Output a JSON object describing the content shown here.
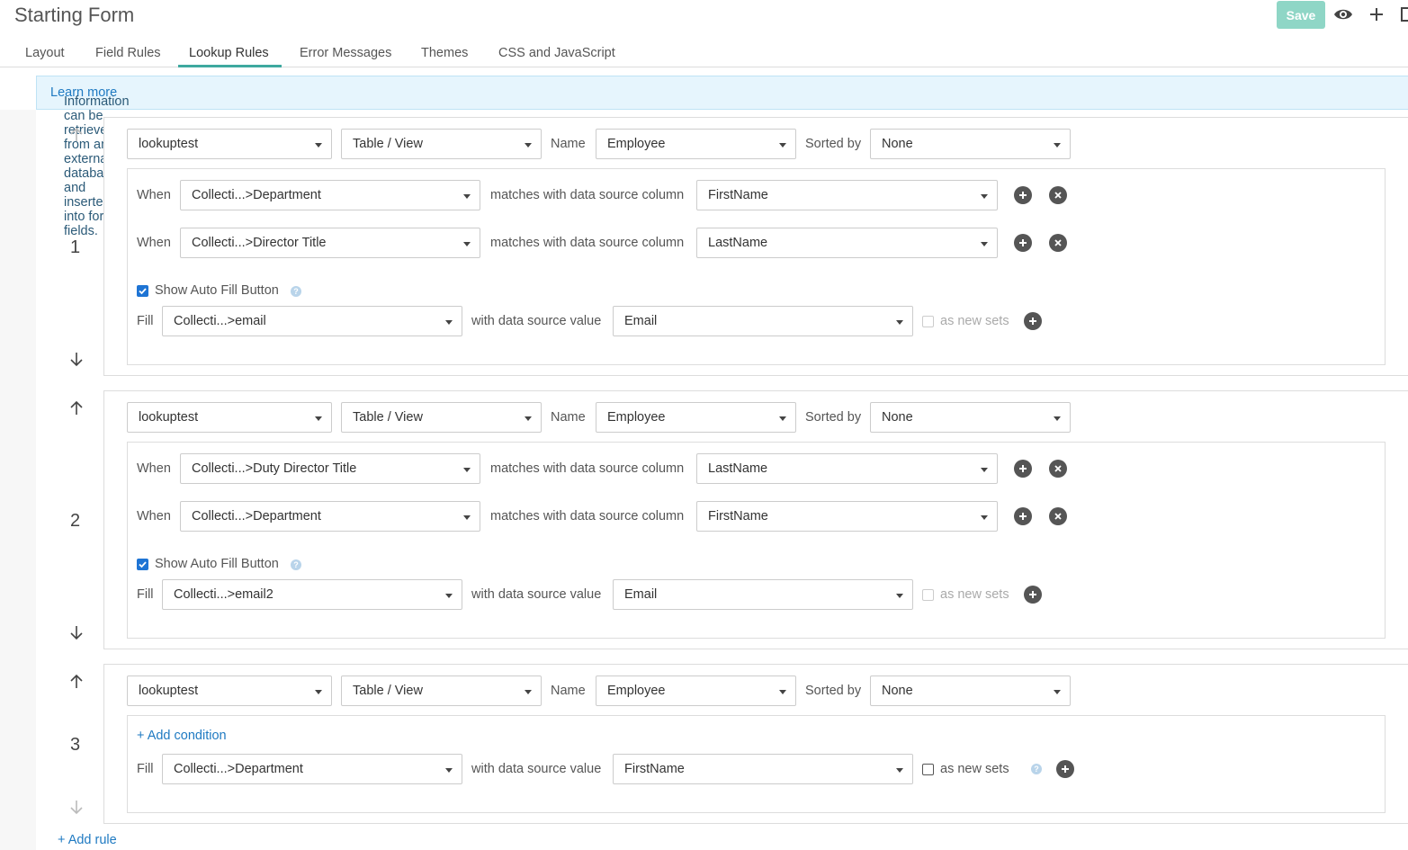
{
  "header": {
    "title": "Starting Form",
    "save_label": "Save"
  },
  "tabs": [
    {
      "label": "Layout"
    },
    {
      "label": "Field Rules"
    },
    {
      "label": "Lookup Rules"
    },
    {
      "label": "Error Messages"
    },
    {
      "label": "Themes"
    },
    {
      "label": "CSS and JavaScript"
    }
  ],
  "info": {
    "text": "Information can be retrieved from an external database and inserted into form fields.",
    "link": "Learn more"
  },
  "labels": {
    "name": "Name",
    "sorted_by": "Sorted by",
    "when": "When",
    "matches": "matches with data source column",
    "show_auto_fill": "Show Auto Fill Button",
    "fill": "Fill",
    "with_value": "with data source value",
    "as_new_sets": "as new sets",
    "add_condition": "+ Add condition",
    "add_rule": "+ Add rule"
  },
  "rules": [
    {
      "number": "1",
      "source": "lookuptest",
      "type": "Table / View",
      "name": "Employee",
      "sorted_by": "None",
      "conditions": [
        {
          "field": "Collecti...>Department",
          "column": "FirstName"
        },
        {
          "field": "Collecti...>Director Title",
          "column": "LastName"
        }
      ],
      "fill": {
        "field": "Collecti...>email",
        "value": "Email"
      }
    },
    {
      "number": "2",
      "source": "lookuptest",
      "type": "Table / View",
      "name": "Employee",
      "sorted_by": "None",
      "conditions": [
        {
          "field": "Collecti...>Duty Director Title",
          "column": "LastName"
        },
        {
          "field": "Collecti...>Department",
          "column": "FirstName"
        }
      ],
      "fill": {
        "field": "Collecti...>email2",
        "value": "Email"
      }
    },
    {
      "number": "3",
      "source": "lookuptest",
      "type": "Table / View",
      "name": "Employee",
      "sorted_by": "None",
      "fill": {
        "field": "Collecti...>Department",
        "value": "FirstName"
      }
    }
  ]
}
